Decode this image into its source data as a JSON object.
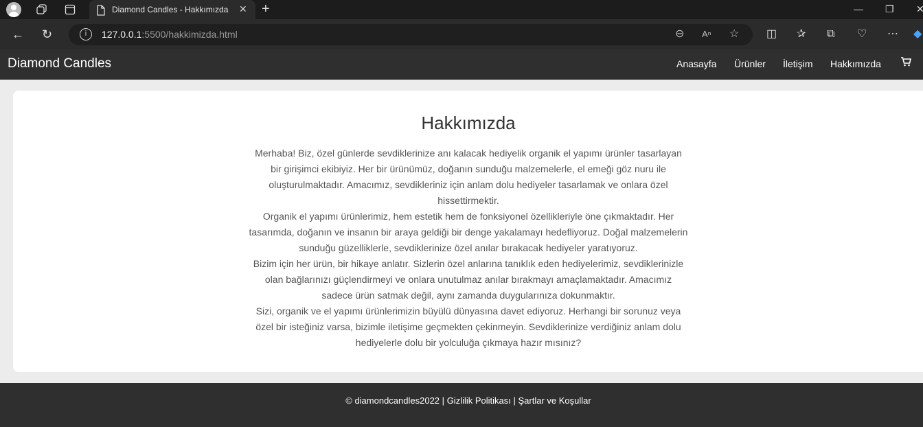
{
  "browser": {
    "tab_title": "Diamond Candles - Hakkımızda",
    "url_host": "127.0.0.1",
    "url_rest": ":5500/hakkimizda.html"
  },
  "site": {
    "brand": "Diamond Candles",
    "nav": [
      "Anasayfa",
      "Ürünler",
      "İletişim",
      "Hakkımızda"
    ]
  },
  "about": {
    "title": "Hakkımızda",
    "paragraphs": [
      "Merhaba! Biz, özel günlerde sevdiklerinize anı kalacak hediyelik organik el yapımı ürünler tasarlayan bir girişimci ekibiyiz. Her bir ürünümüz, doğanın sunduğu malzemelerle, el emeği göz nuru ile oluşturulmaktadır. Amacımız, sevdikleriniz için anlam dolu hediyeler tasarlamak ve onlara özel hissettirmektir.",
      "Organik el yapımı ürünlerimiz, hem estetik hem de fonksiyonel özellikleriyle öne çıkmaktadır. Her tasarımda, doğanın ve insanın bir araya geldiği bir denge yakalamayı hedefliyoruz. Doğal malzemelerin sunduğu güzelliklerle, sevdiklerinize özel anılar bırakacak hediyeler yaratıyoruz.",
      "Bizim için her ürün, bir hikaye anlatır. Sizlerin özel anlarına tanıklık eden hediyelerimiz, sevdiklerinizle olan bağlarınızı güçlendirmeyi ve onlara unutulmaz anılar bırakmayı amaçlamaktadır. Amacımız sadece ürün satmak değil, aynı zamanda duygularınıza dokunmaktır.",
      "Sizi, organik ve el yapımı ürünlerimizin büyülü dünyasına davet ediyoruz. Herhangi bir sorunuz veya özel bir isteğiniz varsa, bizimle iletişime geçmekten çekinmeyin. Sevdiklerinize verdiğiniz anlam dolu hediyelerle dolu bir yolculuğa çıkmaya hazır mısınız?"
    ]
  },
  "footer": {
    "copyright": "© diamondcandles2022",
    "sep": "|",
    "privacy": "Gizlilik Politikası",
    "terms": "Şartlar ve Koşullar"
  }
}
